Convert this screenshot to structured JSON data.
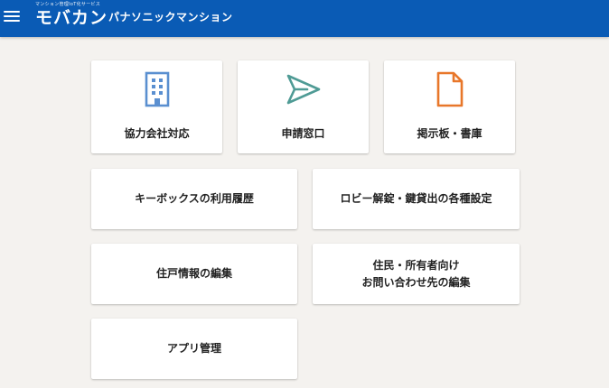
{
  "header": {
    "tagline": "マンション管理IoT化サービス",
    "logo": "モバカン",
    "building_name": "パナソニックマンション",
    "colors": {
      "bar": "#0a5bb5",
      "text": "#ffffff"
    }
  },
  "menu": {
    "icon": "hamburger-menu-icon",
    "icon_cards": [
      {
        "label": "協力会社対応",
        "icon": "building-icon",
        "icon_color": "#5a8fd0"
      },
      {
        "label": "申請窓口",
        "icon": "send-icon",
        "icon_color": "#4f9b95"
      },
      {
        "label": "掲示板・書庫",
        "icon": "document-icon",
        "icon_color": "#e8772a"
      }
    ],
    "cards": [
      {
        "lines": [
          "キーボックスの利用履歴"
        ]
      },
      {
        "lines": [
          "ロビー解錠・鍵貸出の各種設定"
        ]
      },
      {
        "lines": [
          "住戸情報の編集"
        ]
      },
      {
        "lines": [
          "住民・所有者向け",
          "お問い合わせ先の編集"
        ]
      },
      {
        "lines": [
          "アプリ管理"
        ]
      }
    ]
  }
}
